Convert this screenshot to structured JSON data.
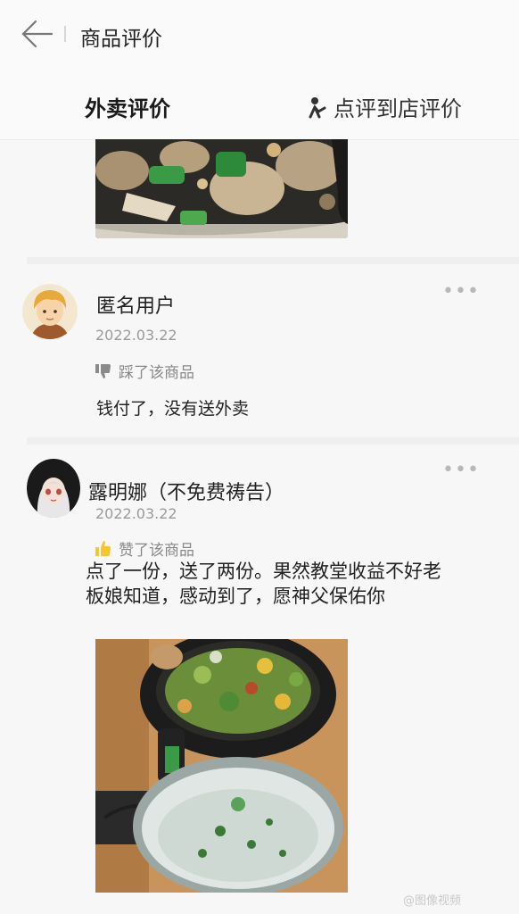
{
  "header": {
    "title": "商品评价"
  },
  "tabs": [
    {
      "label": "外卖评价"
    },
    {
      "label": "点评到店评价"
    }
  ],
  "reviews": [
    {
      "username": "匿名用户",
      "date": "2022.03.22",
      "vote": "踩了该商品",
      "text": "钱付了，没有送外卖",
      "more": "•••",
      "avatar_icon": "anonymous-avatar"
    },
    {
      "username": "露明娜（不免费祷告）",
      "date": "2022.03.22",
      "vote": "赞了该商品",
      "text": "点了一份，送了两份。果然教堂收益不好老板娘知道，感动到了，愿神父保佑你",
      "more": "•••",
      "avatar_icon": "nun-avatar"
    }
  ],
  "watermark": "@图像视频",
  "colors": {
    "thumb_up": "#f5c630",
    "thumb_down": "#8a8a8a",
    "date": "#9a9a9a"
  }
}
